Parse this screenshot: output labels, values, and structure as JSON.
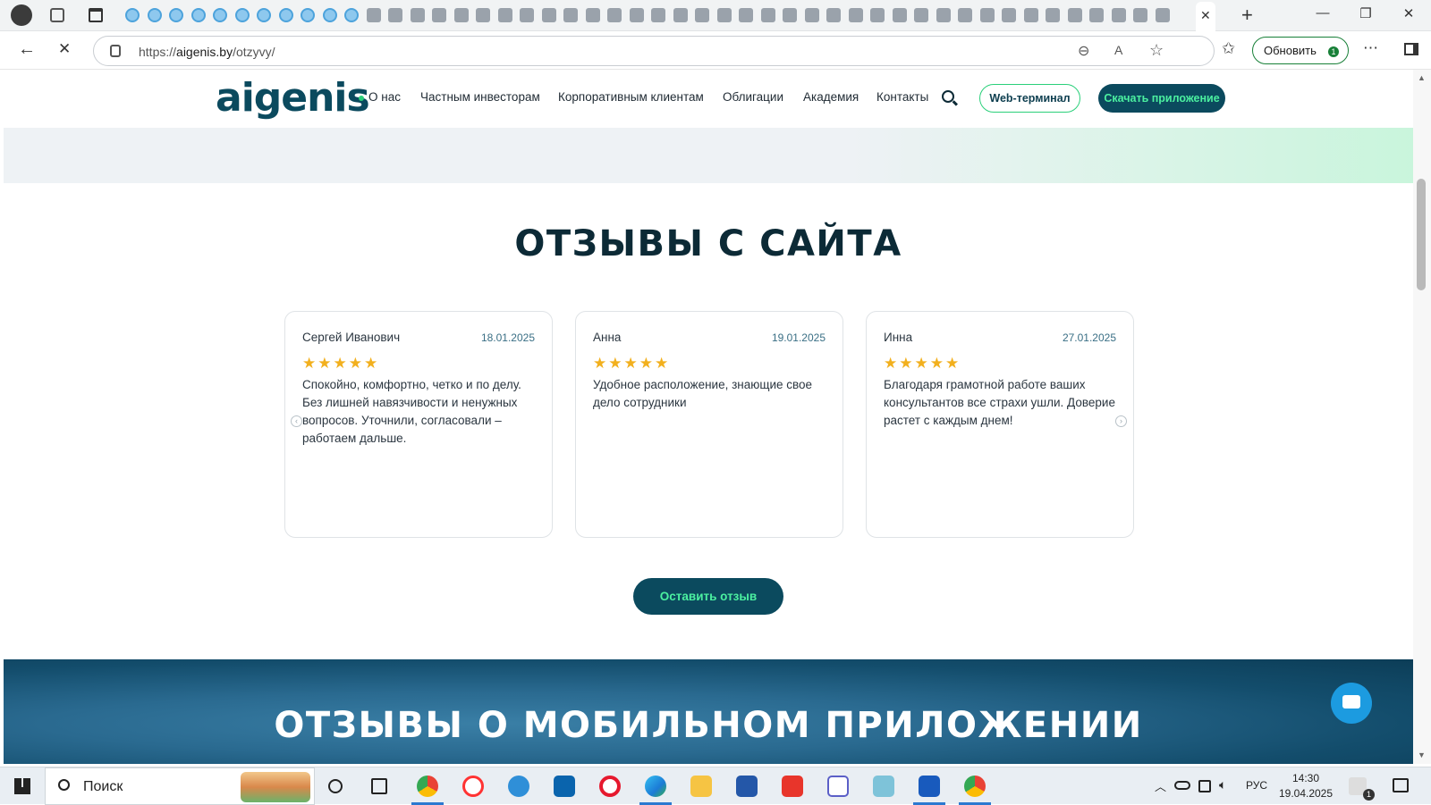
{
  "browser": {
    "url_prefix": "https://",
    "url_host": "aigenis.by",
    "url_path": "/otzyvy/",
    "update_label": "Обновить",
    "update_badge": "1"
  },
  "site": {
    "logo": "aigenis",
    "nav": [
      "О нас",
      "Частным инвесторам",
      "Корпоративным клиентам",
      "Облигации",
      "Академия",
      "Контакты"
    ],
    "web_terminal": "Web-терминал",
    "download_app": "Скачать приложение",
    "accent_color": "#0b4a5e",
    "green_color": "#4bf0a0"
  },
  "reviews": {
    "title": "ОТЗЫВЫ С САЙТА",
    "stars": "★★★★★",
    "items": [
      {
        "name": "Сергей Иванович",
        "date": "18.01.2025",
        "text": "Спокойно, комфортно, четко и по делу. Без лишней навязчивости и ненужных вопросов. Уточнили, согласовали – работаем дальше."
      },
      {
        "name": "Анна",
        "date": "19.01.2025",
        "text": "Удобное расположение, знающие свое дело сотрудники"
      },
      {
        "name": "Инна",
        "date": "27.01.2025",
        "text": "Благодаря грамотной работе ваших консультантов все страхи ушли. Доверие растет с каждым днем!"
      }
    ],
    "leave_review": "Оставить отзыв"
  },
  "mobile": {
    "title": "ОТЗЫВЫ О МОБИЛЬНОМ ПРИЛОЖЕНИИ"
  },
  "taskbar": {
    "search": "Поиск",
    "lang": "РУС",
    "time": "14:30",
    "date": "19.04.2025",
    "notif_count": "1"
  }
}
